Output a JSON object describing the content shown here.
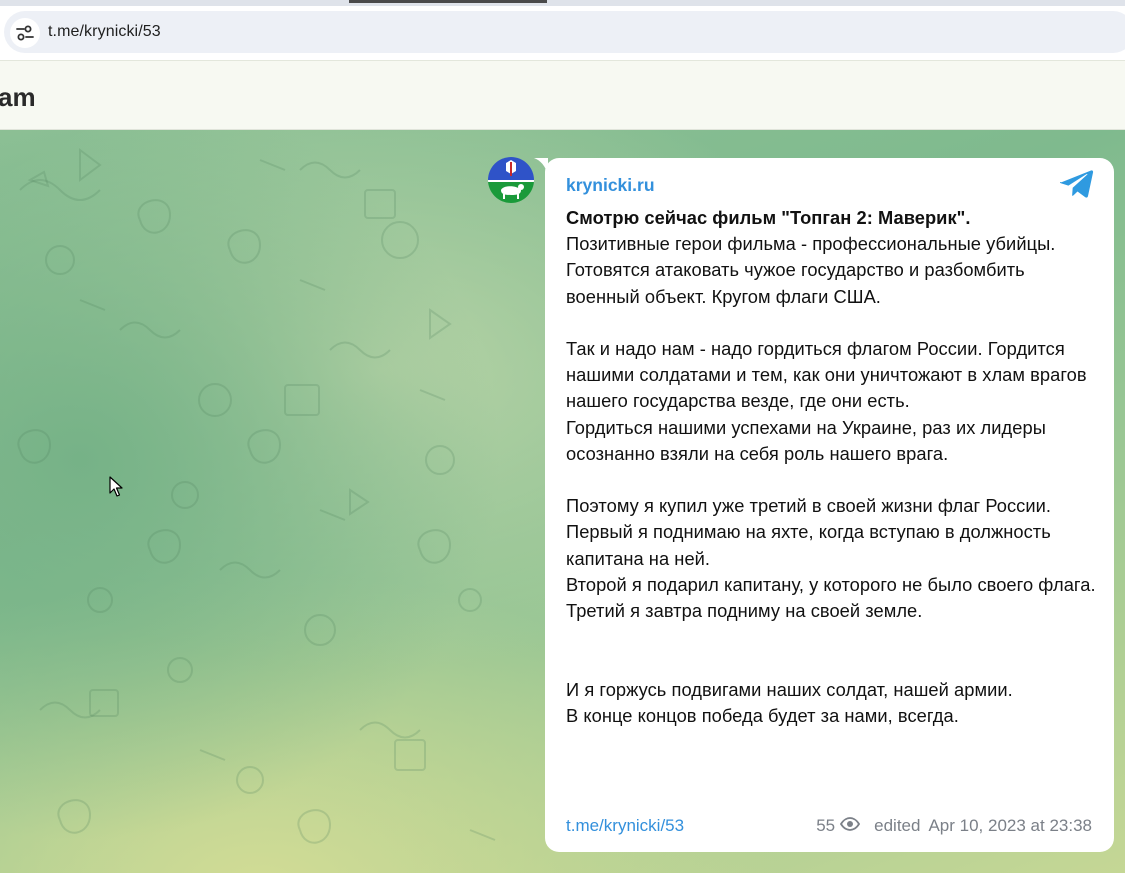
{
  "browser": {
    "url": "t.me/krynicki/53",
    "site_info_icon": "tune-icon"
  },
  "telegram": {
    "header_title": "am"
  },
  "post": {
    "channel_name": "krynicki.ru",
    "lead": "Смотрю сейчас фильм \"Топган 2: Маверик\".",
    "body": "Позитивные герои фильма - профессиональные убийцы. Готовятся атаковать чужое государство и разбомбить военный объект. Кругом флаги США.\n\nТак и надо нам - надо гордиться флагом России. Гордится нашими солдатами и тем, как они уничтожают в хлам врагов нашего государства везде, где они есть.\nГордиться нашими успехами на Украине, раз их лидеры осознанно взяли на себя роль нашего врага.\n\nПоэтому я купил уже третий в своей жизни флаг России.\nПервый я поднимаю на яхте, когда вступаю в должность капитана на ней.\nВторой я подарил капитану, у которого не было своего флага.\nТретий я завтра подниму на своей земле.\n\n\nИ я горжусь подвигами наших солдат, нашей армии.\nВ конце концов победа будет за нами, всегда.",
    "link": "t.me/krynicki/53",
    "views": "55",
    "edited_label": "edited",
    "date": "Apr 10, 2023 at 23:38"
  },
  "colors": {
    "accent": "#3390dc",
    "bubble": "#ffffff",
    "meta": "#7b8088"
  }
}
